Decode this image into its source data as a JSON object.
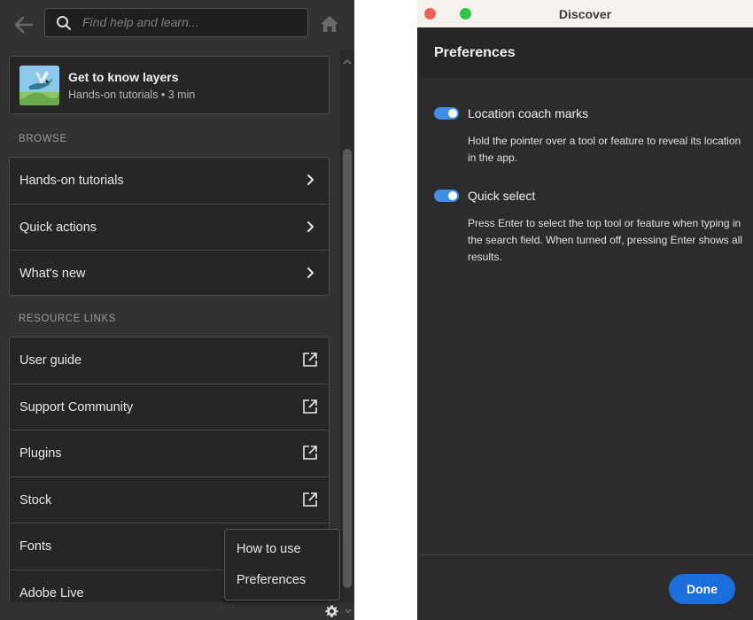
{
  "left_panel": {
    "search": {
      "placeholder": "Find help and learn..."
    },
    "featured": {
      "title": "Get to know layers",
      "subtitle": "Hands-on tutorials • 3 min"
    },
    "browse": {
      "label": "BROWSE",
      "items": [
        {
          "label": "Hands-on tutorials",
          "icon": "chevron-right-icon"
        },
        {
          "label": "Quick actions",
          "icon": "chevron-right-icon"
        },
        {
          "label": "What's new",
          "icon": "chevron-right-icon"
        }
      ]
    },
    "resources": {
      "label": "RESOURCE LINKS",
      "items": [
        {
          "label": "User guide",
          "icon": "external-link-icon"
        },
        {
          "label": "Support Community",
          "icon": "external-link-icon"
        },
        {
          "label": "Plugins",
          "icon": "external-link-icon"
        },
        {
          "label": "Stock",
          "icon": "external-link-icon"
        },
        {
          "label": "Fonts",
          "icon": "external-link-icon"
        },
        {
          "label": "Adobe Live",
          "icon": "external-link-icon"
        }
      ]
    },
    "context_menu": {
      "items": [
        "How to use",
        "Preferences"
      ]
    }
  },
  "window": {
    "title": "Discover",
    "section_title": "Preferences",
    "options": [
      {
        "label": "Location coach marks",
        "enabled": true,
        "description": "Hold the pointer over a tool or feature to reveal its location in the app."
      },
      {
        "label": "Quick select",
        "enabled": true,
        "description": "Press Enter to select the top tool or feature when typing in the search field. When turned off, pressing Enter shows all results."
      }
    ],
    "done_label": "Done"
  },
  "colors": {
    "panel_bg": "#323232",
    "list_bg": "#262626",
    "toggle_on": "#3f8ee8",
    "done_button": "#1b6fdd",
    "traffic_red": "#ed5f57",
    "traffic_green": "#2ec448"
  }
}
